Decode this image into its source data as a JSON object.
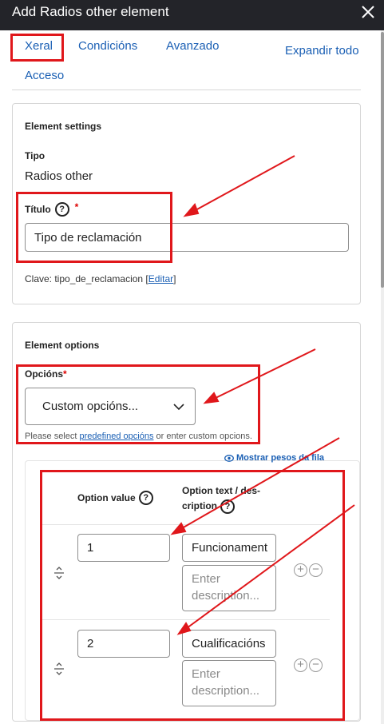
{
  "dialog": {
    "title": "Add Radios other element"
  },
  "tabs": {
    "xeral": "Xeral",
    "condicions": "Condicións",
    "avanzado": "Avanzado",
    "acceso": "Acceso",
    "expand_all": "Expandir todo"
  },
  "element_settings": {
    "heading": "Element settings",
    "tipo_label": "Tipo",
    "tipo_value": "Radios other",
    "titulo_label": "Título",
    "titulo_required": "*",
    "titulo_value": "Tipo de reclamación",
    "clave_prefix": "Clave: tipo_de_reclamacion [",
    "clave_link": "Editar",
    "clave_suffix": "]"
  },
  "element_options": {
    "heading": "Element options",
    "opcions_label": "Opcións",
    "opcions_required": "*",
    "select_value": "Custom opcións...",
    "hint_prefix": "Please select ",
    "hint_link": "predefined opcións",
    "hint_suffix": " or enter custom opcions.",
    "show_weights": "Mostrar pesos da fila",
    "col_value": "Option value",
    "col_text_line1": "Option text / des-",
    "col_text_line2": "cription",
    "description_placeholder_line1": "Enter",
    "description_placeholder_line2": "description...",
    "rows": [
      {
        "value": "1",
        "text": "Funcionament"
      },
      {
        "value": "2",
        "text": "Cualificacións"
      }
    ]
  },
  "icons": {
    "close": "close-icon",
    "help": "help-icon",
    "chevron": "chevron-down-icon",
    "eye": "eye-icon",
    "drag": "drag-handle-icon",
    "add": "add-icon",
    "remove": "remove-icon"
  },
  "colors": {
    "titlebar": "#232429",
    "link": "#1a5fb4",
    "annotation": "#e0171b",
    "required": "#dd0000"
  }
}
